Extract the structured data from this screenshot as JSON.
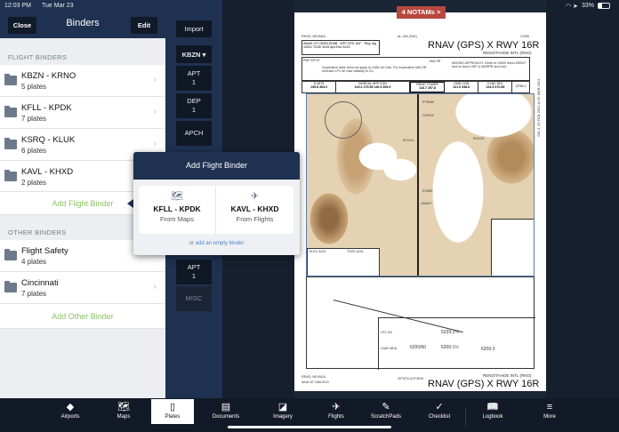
{
  "status": {
    "time": "12:03 PM",
    "date": "Tue Mar 23",
    "battery": "33%"
  },
  "binders": {
    "close": "Close",
    "title": "Binders",
    "edit": "Edit",
    "flight_header": "FLIGHT BINDERS",
    "flight": [
      {
        "name": "KBZN - KRNO",
        "sub": "5 plates"
      },
      {
        "name": "KFLL - KPDK",
        "sub": "7 plates"
      },
      {
        "name": "KSRQ - KLUK",
        "sub": "6 plates"
      },
      {
        "name": "KAVL - KHXD",
        "sub": "2 plates"
      }
    ],
    "add_flight": "Add Flight Binder",
    "other_header": "OTHER BINDERS",
    "other": [
      {
        "name": "Flight Safety",
        "sub": "4 plates"
      },
      {
        "name": "Cincinnati",
        "sub": "7 plates"
      }
    ],
    "add_other": "Add Other Binder"
  },
  "nav": {
    "import": "Import",
    "airport": "KBZN",
    "apt": "APT",
    "apt_n": "1",
    "dep": "DEP",
    "dep_n": "1",
    "apch": "APCH",
    "apt2": "APT",
    "apt2_n": "1",
    "misc": "MISC"
  },
  "popover": {
    "title": "Add Flight Binder",
    "opt1_name": "KFLL - KPDK",
    "opt1_sub": "From Maps",
    "opt2_name": "KAVL - KHXD",
    "opt2_sub": "From Flights",
    "foot_prefix": "or",
    "foot_link": "add an empty binder"
  },
  "chart": {
    "notams": "4 NOTAMs >",
    "location": "RENO, NEVADA",
    "agency": "AL-346 (FAA)",
    "code": "21056",
    "title": "RNAV (GPS) X RWY 16R",
    "airport": "RENO/TAHOE INTL (RNO)",
    "waas": "WAAS CH 78309 W16B",
    "app_crs": "APP CRS 164°",
    "rwy": "Rwy Idg 10001 TDZE 4415 Apt Elev 4415",
    "rnp": "RNP APCH",
    "note": "Inoperative table does not apply to LNAV all Cats. For inoperative MALSR increase LPV all Cats visibility to 2¼.",
    "malsr": "MALSR",
    "missed": "MISSED APPROACH: Climb to 13000 direct ZEBUT and on track 158° to MARRR and hold.",
    "freqs": [
      {
        "l": "D-ATIS",
        "v": "135.8 363.0"
      },
      {
        "l": "NORCAL APP CON",
        "v": "119.2 279.55  126.3 353.9"
      },
      {
        "l": "RENO TOWER",
        "v": "118.7 257.8"
      },
      {
        "l": "GND CON",
        "v": "121.9 348.6"
      },
      {
        "l": "CLNC DEL",
        "v": "124.9 370.85"
      },
      {
        "l": "CPDLC",
        "v": ""
      }
    ],
    "fixes": [
      "PYRAM",
      "CEROX",
      "ECOLO",
      "ROXJO",
      "STARE",
      "UDADY",
      "ZEXUT",
      "MARRR"
    ],
    "elev": "ELEV 4415",
    "tdze": "TDZE 4415",
    "lpv": "LPV DA",
    "lpv_min": "5239-2¼",
    "lnav": "LNAV MDA",
    "lnav_a": "6200/60",
    "lnav_b": "6200-1½",
    "lnav_c": "6200-3",
    "side": "SW-4, 25 FEB 2021 to 25 MAR 2021",
    "amdt": "Amdt 1E 15AUG19",
    "coords": "39°30'N-119°46'W"
  },
  "tabs": [
    {
      "label": "Airports",
      "icon": "◆"
    },
    {
      "label": "Maps",
      "icon": "🗺"
    },
    {
      "label": "Plates",
      "icon": "▯"
    },
    {
      "label": "Documents",
      "icon": "▤"
    },
    {
      "label": "Imagery",
      "icon": "◪"
    },
    {
      "label": "Flights",
      "icon": "✈"
    },
    {
      "label": "ScratchPads",
      "icon": "✎"
    },
    {
      "label": "Checklist",
      "icon": "✓"
    },
    {
      "label": "Logbook",
      "icon": "📖"
    },
    {
      "label": "More",
      "icon": "≡"
    }
  ]
}
